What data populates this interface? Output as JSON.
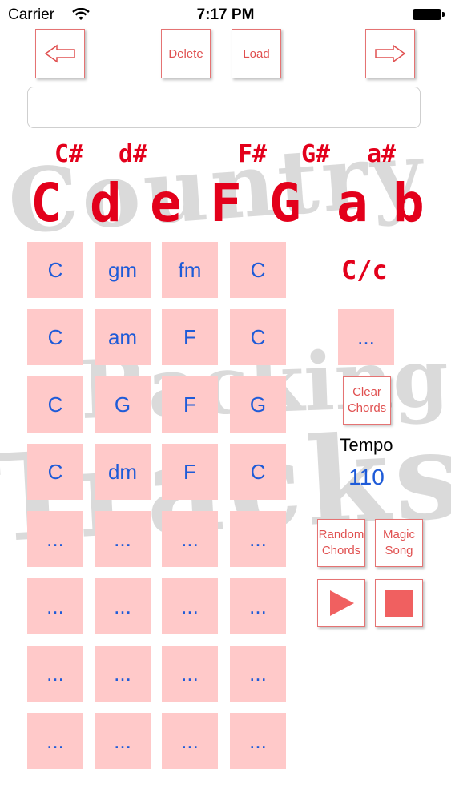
{
  "status_bar": {
    "carrier": "Carrier",
    "time": "7:17 PM"
  },
  "toolbar": {
    "delete_label": "Delete",
    "load_label": "Load"
  },
  "song_name": {
    "value": ""
  },
  "watermark": {
    "line1": "Country",
    "line2": "Backing",
    "line3": "Tracks"
  },
  "keys": {
    "sharps": [
      "C#",
      "d#",
      "F#",
      "G#",
      "a#"
    ],
    "naturals": [
      "C",
      "d",
      "e",
      "F",
      "G",
      "a",
      "b"
    ]
  },
  "grid": {
    "rows": [
      [
        "C",
        "gm",
        "fm",
        "C"
      ],
      [
        "C",
        "am",
        "F",
        "C"
      ],
      [
        "C",
        "G",
        "F",
        "G"
      ],
      [
        "C",
        "dm",
        "F",
        "C"
      ],
      [
        "...",
        "...",
        "...",
        "..."
      ],
      [
        "...",
        "...",
        "...",
        "..."
      ],
      [
        "...",
        "...",
        "...",
        "..."
      ],
      [
        "...",
        "...",
        "...",
        "..."
      ]
    ]
  },
  "side": {
    "mode_label": "C/c",
    "current_chord": "...",
    "clear_label": "Clear Chords",
    "tempo_label": "Tempo",
    "tempo_value": "110",
    "random_label": "Random Chords",
    "magic_label": "Magic Song"
  },
  "colors": {
    "accent": "#e3001b",
    "cell_bg": "#ffc9c9",
    "chord_text": "#1e5bd8",
    "button_border": "#e57373"
  }
}
